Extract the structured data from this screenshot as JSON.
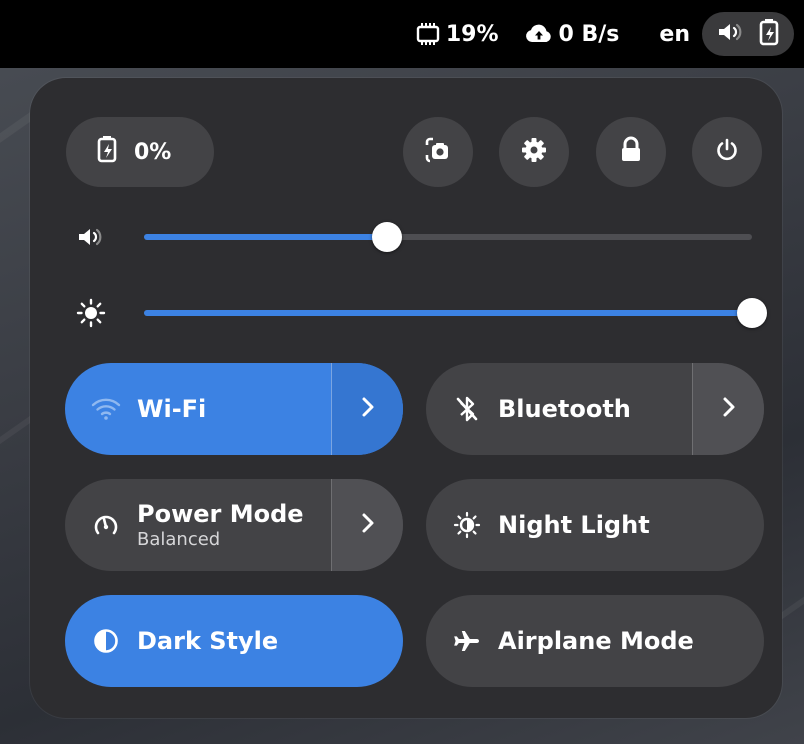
{
  "topbar": {
    "cpu_icon": "cpu-icon",
    "cpu_value": "19%",
    "network_icon": "cloud-upload-icon",
    "network_value": "0 B/s",
    "language": "en",
    "volume_icon": "volume-icon",
    "battery_icon": "battery-charging-icon"
  },
  "quick_settings": {
    "battery": {
      "icon": "battery-charging-icon",
      "value": "0%"
    },
    "actions": [
      {
        "name": "screenshot",
        "icon": "screenshot-icon"
      },
      {
        "name": "settings",
        "icon": "gear-icon"
      },
      {
        "name": "lock",
        "icon": "lock-icon"
      },
      {
        "name": "power",
        "icon": "power-icon"
      }
    ],
    "volume": {
      "icon": "volume-icon",
      "level": 0.4
    },
    "brightness": {
      "icon": "brightness-icon",
      "level": 1.0
    },
    "tiles": {
      "wifi": {
        "label": "Wi-Fi",
        "icon": "wifi-icon",
        "active": true
      },
      "bluetooth": {
        "label": "Bluetooth",
        "icon": "bluetooth-disabled-icon",
        "active": false
      },
      "power_mode": {
        "label": "Power Mode",
        "sublabel": "Balanced",
        "icon": "power-mode-icon",
        "active": false
      },
      "night_light": {
        "label": "Night Light",
        "icon": "night-light-icon",
        "active": false
      },
      "dark_style": {
        "label": "Dark Style",
        "icon": "dark-style-icon",
        "active": true
      },
      "airplane_mode": {
        "label": "Airplane Mode",
        "icon": "airplane-icon",
        "active": false
      }
    }
  },
  "colors": {
    "accent": "#3c82e3",
    "panel": "#2d2d30",
    "tile": "#434346"
  }
}
